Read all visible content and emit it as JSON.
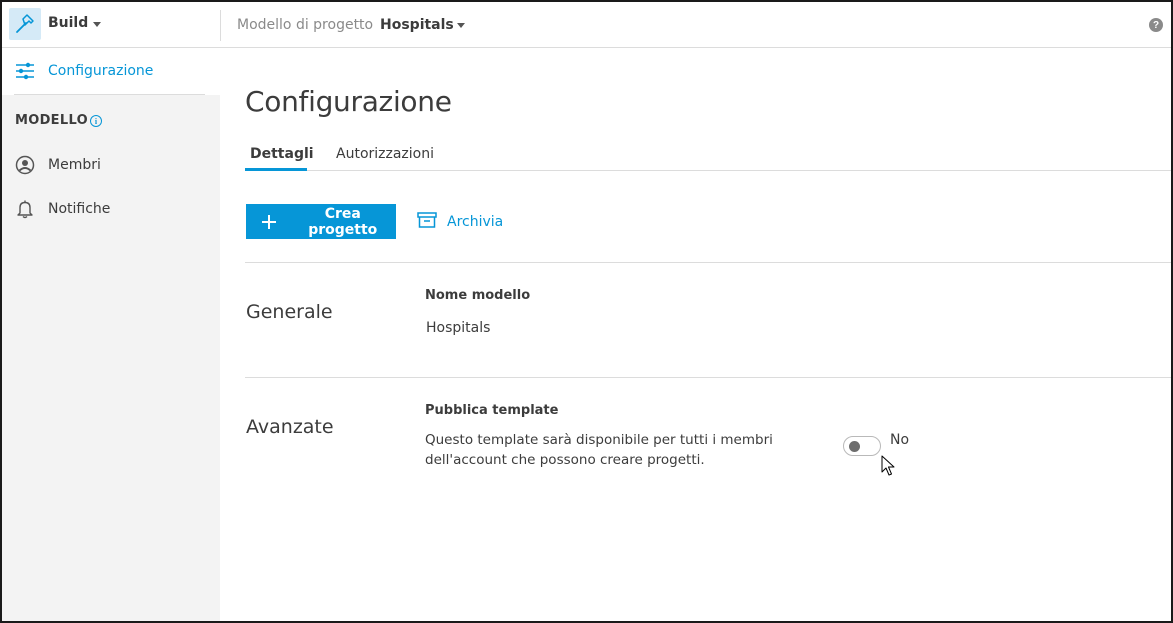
{
  "topbar": {
    "app_name": "Build",
    "template_label": "Modello di progetto",
    "template_name": "Hospitals",
    "help_icon": "?"
  },
  "sidebar": {
    "active_item": "Configurazione",
    "section_title": "MODELLO",
    "items": [
      {
        "label": "Membri",
        "icon": "person-icon"
      },
      {
        "label": "Notifiche",
        "icon": "bell-icon"
      }
    ]
  },
  "main": {
    "title": "Configurazione",
    "tabs": [
      {
        "label": "Dettagli",
        "active": true
      },
      {
        "label": "Autorizzazioni",
        "active": false
      }
    ],
    "actions": {
      "create_label": "Crea progetto",
      "archive_label": "Archivia"
    },
    "general": {
      "title": "Generale",
      "field_label": "Nome modello",
      "field_value": "Hospitals"
    },
    "advanced": {
      "title": "Avanzate",
      "field_label": "Pubblica template",
      "description_line1": "Questo template sarà disponibile per tutti i membri",
      "description_line2": "dell'account che possono creare progetti.",
      "toggle_state": "No",
      "toggle_on": false
    }
  },
  "colors": {
    "accent": "#0696d7",
    "sidebar_bg": "#f3f3f3",
    "text": "#3c3c3c",
    "border": "#dcdcdc"
  }
}
